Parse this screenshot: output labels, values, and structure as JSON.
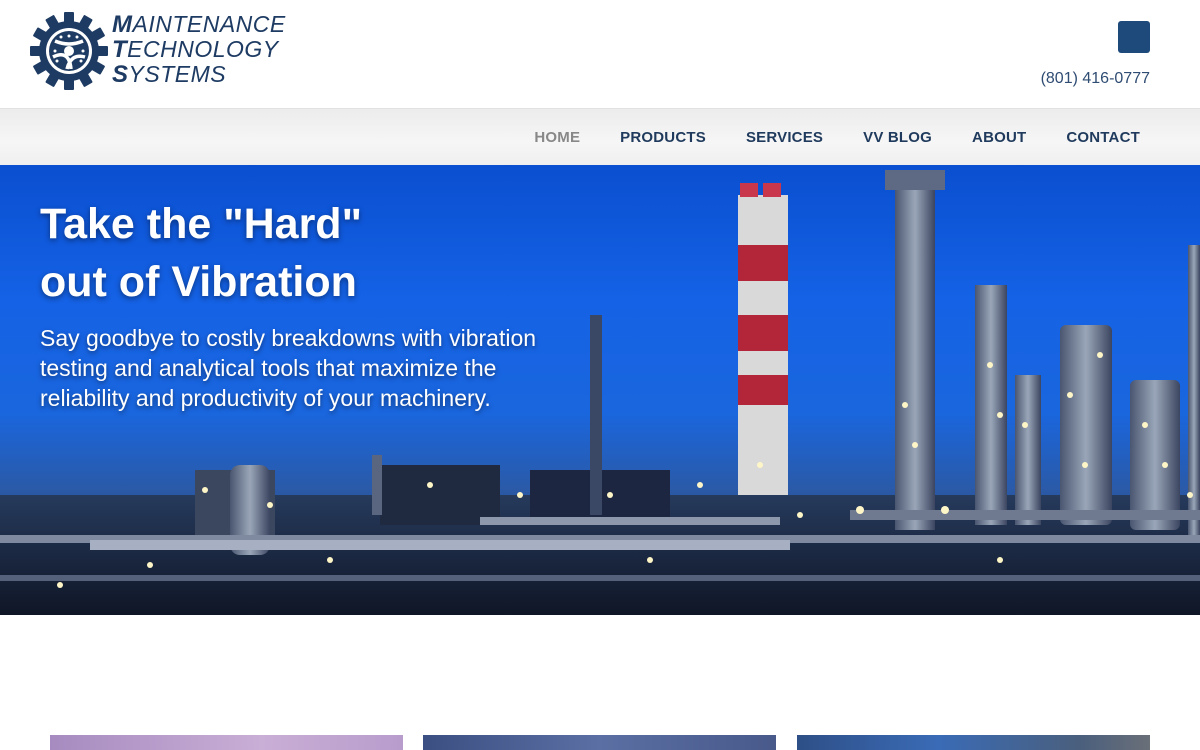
{
  "brand": {
    "line1_cap": "M",
    "line1_rest": "AINTENANCE",
    "line2_cap": "T",
    "line2_rest": "ECHNOLOGY",
    "line3_cap": "S",
    "line3_rest": "YSTEMS",
    "color": "#1e3b63"
  },
  "header": {
    "phone": "(801) 416-0777"
  },
  "nav": {
    "items": [
      {
        "label": "HOME",
        "active": true
      },
      {
        "label": "PRODUCTS",
        "active": false
      },
      {
        "label": "SERVICES",
        "active": false
      },
      {
        "label": "VV BLOG",
        "active": false
      },
      {
        "label": "ABOUT",
        "active": false
      },
      {
        "label": "CONTACT",
        "active": false
      }
    ]
  },
  "hero": {
    "title_line1": "Take the \"Hard\"",
    "title_line2": "out of Vibration",
    "subtitle": "Say goodbye to costly breakdowns with vibration testing and analytical tools that maximize the reliability and productivity of your machinery."
  },
  "colors": {
    "nav_text": "#1f3a5c",
    "nav_active": "#888888",
    "hero_sky": "#1562e6",
    "accent_square": "#1e4a7b"
  }
}
